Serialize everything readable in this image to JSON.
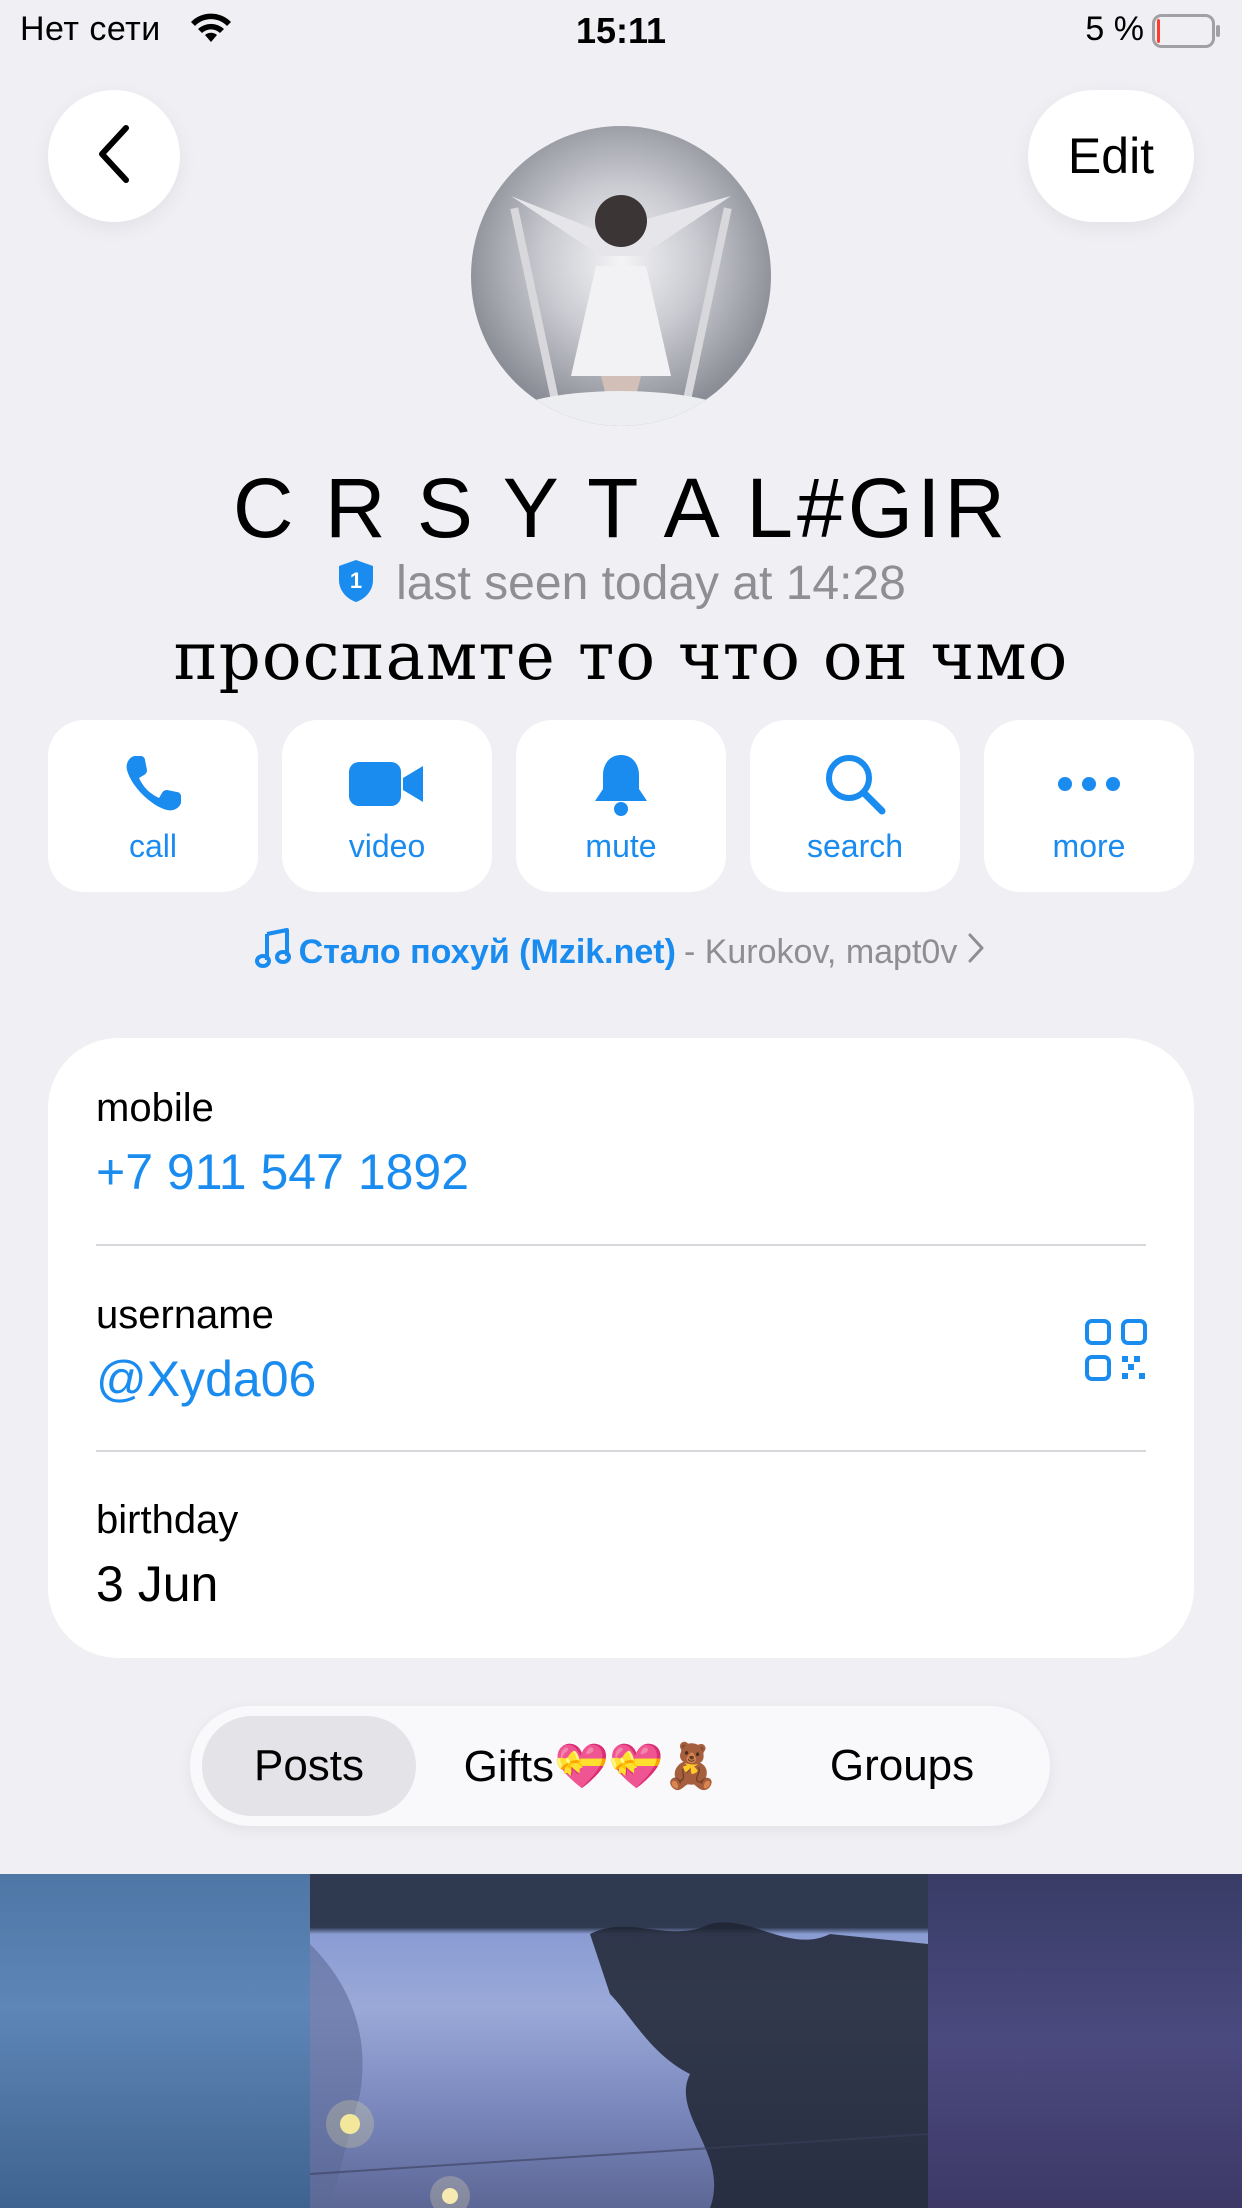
{
  "status_bar": {
    "carrier": "Нет сети",
    "time": "15:11",
    "battery_percent": "5 %",
    "battery_level": 0.05
  },
  "header": {
    "back_icon": "chevron-left-icon",
    "edit_label": "Edit"
  },
  "profile": {
    "name": "C R S Y T A L#GIR",
    "badge_number": "1",
    "last_seen": "last seen today at 14:28",
    "bio": "проспамте то что он чмо"
  },
  "actions": [
    {
      "label": "call",
      "icon": "phone-icon"
    },
    {
      "label": "video",
      "icon": "video-camera-icon"
    },
    {
      "label": "mute",
      "icon": "bell-icon"
    },
    {
      "label": "search",
      "icon": "search-icon"
    },
    {
      "label": "more",
      "icon": "more-dots-icon"
    }
  ],
  "music": {
    "title": "Стало похуй (Mzik.net)",
    "artist": "- Kurokov, mapt0v"
  },
  "info": {
    "mobile_label": "mobile",
    "mobile_value": "+7 911 547 1892",
    "username_label": "username",
    "username_value": "@Xyda06",
    "birthday_label": "birthday",
    "birthday_value": "3 Jun"
  },
  "tabs": [
    {
      "label": "Posts",
      "active": true
    },
    {
      "label": "Gifts💝💝🧸",
      "active": false
    },
    {
      "label": "Groups",
      "active": false
    }
  ],
  "colors": {
    "accent": "#1a8cf0",
    "background": "#efeff4",
    "secondary_text": "#8e8e93"
  }
}
